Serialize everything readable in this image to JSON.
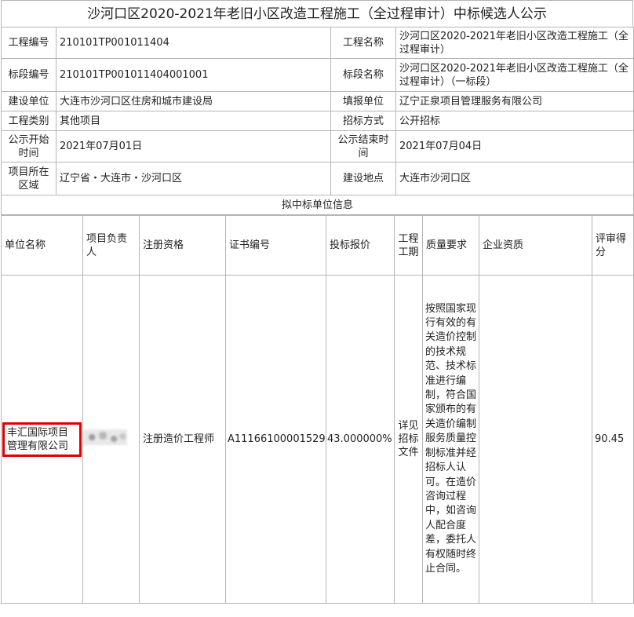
{
  "title": "沙河口区2020-2021年老旧小区改造工程施工（全过程审计）中标候选人公示",
  "info": {
    "project_code_label": "工程编号",
    "project_code": "210101TP001011404",
    "project_name_label": "工程名称",
    "project_name": "沙河口区2020-2021年老旧小区改造工程施工（全过程审计）",
    "section_code_label": "标段编号",
    "section_code": "210101TP001011404001001",
    "section_name_label": "标段名称",
    "section_name": "沙河口区2020-2021年老旧小区改造工程施工（全过程审计）（一标段）",
    "builder_label": "建设单位",
    "builder": "大连市沙河口区住房和城市建设局",
    "reporter_label": "填报单位",
    "reporter": "辽宁正泉项目管理服务有限公司",
    "category_label": "工程类别",
    "category": "其他项目",
    "bid_method_label": "招标方式",
    "bid_method": "公开招标",
    "start_label": "公示开始时间",
    "start_date": "2021年07月01日",
    "end_label": "公示结束时间",
    "end_date": "2021年07月04日",
    "region_label": "项目所在区域",
    "region": "辽宁省・大连市・沙河口区",
    "location_label": "建设地点",
    "location": "大连市沙河口区"
  },
  "candidates_section_title": "拟中标单位信息",
  "columns": {
    "unit_name": "单位名称",
    "manager": "项目负责人",
    "qualification": "注册资格",
    "cert_no": "证书编号",
    "bid_price": "投标报价",
    "period": "工程工期",
    "quality": "质量要求",
    "enterprise_qual": "企业资质",
    "score": "评审得分"
  },
  "candidate": {
    "unit_name": "丰汇国际项目管理有限公司",
    "qualification": "注册造价工程师",
    "cert_no": "A11166100001529",
    "bid_price": "43.000000%",
    "period": "详见招标文件",
    "quality": "按照国家现行有效的有关造价控制的技术规范、技术标准进行编制，符合国家颁布的有关造价编制服务质量控制标准并经招标人认可。在造价咨询过程中，如咨询人配合度差，委托人有权随时终止合同。",
    "enterprise_qual": "",
    "score": "90.45"
  },
  "colors": {
    "border": "#b5b5b5",
    "highlight": "#e00000",
    "text": "#222222"
  }
}
